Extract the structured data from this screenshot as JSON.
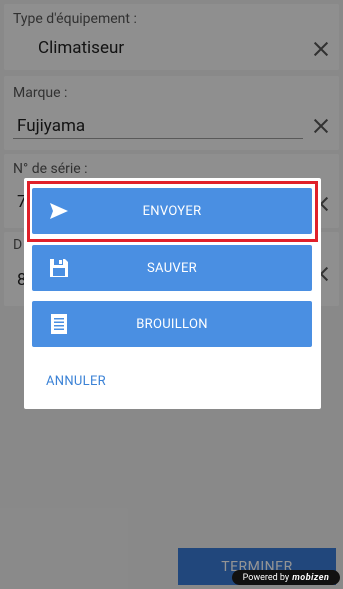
{
  "form": {
    "type_label": "Type d'équipement :",
    "type_value": "Climatiseur",
    "brand_label": "Marque :",
    "brand_value": "Fujiyama",
    "serial_label": "N° de série :",
    "serial_value_partial": "7",
    "date_label_partial": "D",
    "date_value_partial": "8"
  },
  "footer": {
    "finish_label": "TERMINER"
  },
  "dialog": {
    "send_label": "ENVOYER",
    "save_label": "SAUVER",
    "draft_label": "BROUILLON",
    "cancel_label": "ANNULER"
  },
  "overlay_badge": {
    "prefix": "Powered by",
    "brand": "mobizen"
  },
  "colors": {
    "button_blue": "#4a8fe2",
    "highlight_red": "#e0202a",
    "cancel_text": "#3b82d6"
  },
  "icons": {
    "send": "send-icon",
    "save": "floppy-disk-icon",
    "draft": "document-icon",
    "clear": "close-icon"
  }
}
